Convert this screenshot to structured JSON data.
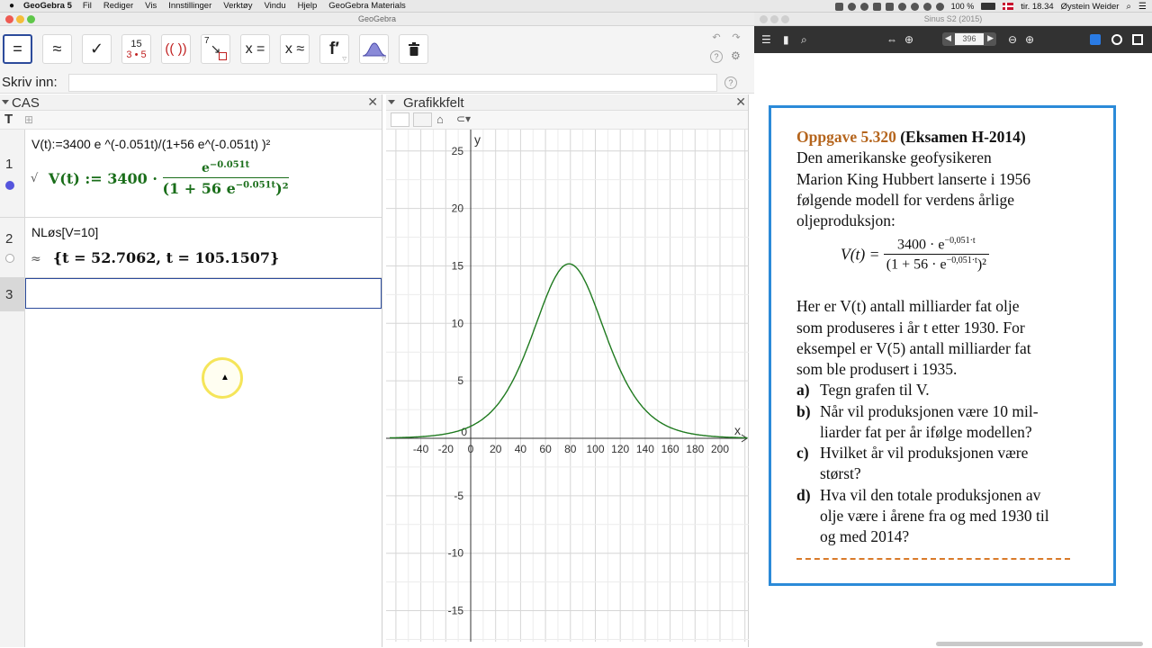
{
  "menubar": {
    "app_name": "GeoGebra 5",
    "items": [
      "Fil",
      "Rediger",
      "Vis",
      "Innstillinger",
      "Verktøy",
      "Vindu",
      "Hjelp",
      "GeoGebra Materials"
    ],
    "battery": "100 %",
    "clock": "tir. 18.34",
    "user": "Øystein Weider"
  },
  "window": {
    "title": "GeoGebra"
  },
  "toolbar": {
    "tools": [
      {
        "name": "evaluate-tool",
        "label": "="
      },
      {
        "name": "numeric-tool",
        "label": "≈"
      },
      {
        "name": "keep-input-tool",
        "label": "✓"
      },
      {
        "name": "factor-tool",
        "label_top": "15",
        "label_bottom": "3 • 5"
      },
      {
        "name": "expand-tool",
        "label": "(( ))"
      },
      {
        "name": "substitute-tool",
        "label": "7"
      },
      {
        "name": "solve-tool",
        "label": "x ="
      },
      {
        "name": "solve-numerically-tool",
        "label": "x ≈"
      },
      {
        "name": "derivative-tool",
        "label": "f′"
      },
      {
        "name": "probability-tool",
        "label": ""
      },
      {
        "name": "delete-tool",
        "label": ""
      }
    ]
  },
  "inputbar": {
    "label": "Skriv inn:",
    "value": ""
  },
  "cas": {
    "title": "CAS",
    "format_T": "T",
    "rows": [
      {
        "num": "1",
        "input": "V(t):=3400 e ^(-0.051t)/(1+56 e^(-0.051t) )²",
        "out_prefix": "√",
        "out_lhs": "V(t) := 3400 ·",
        "out_num": "e",
        "out_num_sup": "−0.051t",
        "out_den": "(1 + 56 e",
        "out_den_sup": "−0.051t",
        "out_den_end": ")²"
      },
      {
        "num": "2",
        "input": "NLøs[V=10]",
        "out_prefix": "≈",
        "output": "{t = 52.7062, t = 105.1507}"
      },
      {
        "num": "3",
        "input": ""
      }
    ]
  },
  "graphics": {
    "title": "Grafikkfelt",
    "x_axis_label": "x",
    "y_axis_label": "y"
  },
  "chart_data": {
    "type": "line",
    "title": "",
    "xlabel": "x",
    "ylabel": "y",
    "xlim": [
      -65,
      222
    ],
    "ylim": [
      -17,
      26
    ],
    "x_ticks": [
      -40,
      -20,
      0,
      20,
      40,
      60,
      80,
      100,
      120,
      140,
      160,
      180,
      200
    ],
    "y_ticks": [
      -15,
      -10,
      -5,
      0,
      5,
      10,
      15,
      20,
      25
    ],
    "function": "V(t)=3400e^(-0.051t)/(1+56e^(-0.051t))^2",
    "coefficients": {
      "a": 3400,
      "b": 56,
      "k": 0.051
    },
    "peak": {
      "x": 79,
      "y": 15.2
    },
    "grid": true,
    "color": "#1f7a1f"
  },
  "viewer": {
    "title": "Sinus S2 (2015)",
    "page": "396"
  },
  "document": {
    "heading_num": "Oppgave 5.320",
    "heading_rest": "(Eksamen H-2014)",
    "intro": [
      "Den amerikanske geofysikeren",
      "Marion King Hubbert lanserte i 1956",
      "følgende modell for verdens årlige",
      "oljeproduksjon:"
    ],
    "formula_lhs": "V(t) =",
    "formula_num": "3400 · e",
    "formula_num_sup": "−0,051·t",
    "formula_den": "(1 + 56 · e",
    "formula_den_sup": "−0,051·t",
    "formula_den_end": ")²",
    "body": [
      "Her er V(t) antall milliarder fat olje",
      "som produseres i år t etter 1930. For",
      "eksempel er V(5) antall milliarder fat",
      "som ble produsert i 1935."
    ],
    "tasks": [
      {
        "label": "a)",
        "lines": [
          "Tegn grafen til V."
        ]
      },
      {
        "label": "b)",
        "lines": [
          "Når vil produksjonen være 10 mil-",
          "liarder fat per år ifølge modellen?"
        ]
      },
      {
        "label": "c)",
        "lines": [
          "Hvilket år vil produksjonen være",
          "størst?"
        ]
      },
      {
        "label": "d)",
        "lines": [
          "Hva vil den totale produksjonen av",
          "olje være i årene fra og med 1930 til",
          "og med 2014?"
        ]
      }
    ]
  }
}
